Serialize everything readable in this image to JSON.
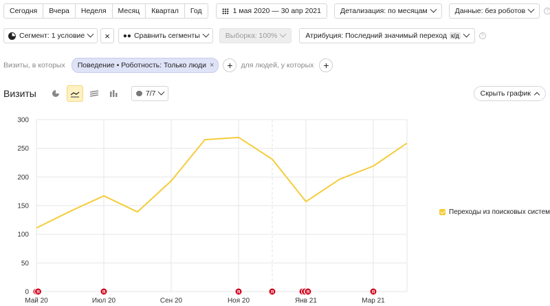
{
  "toolbar": {
    "periods": [
      "Сегодня",
      "Вчера",
      "Неделя",
      "Месяц",
      "Квартал",
      "Год"
    ],
    "date_range": "1 мая 2020 — 30 апр 2021",
    "detail": "Детализация: по месяцам",
    "robots": "Данные: без роботов"
  },
  "segments": {
    "segment": "Сегмент: 1 условие",
    "compare": "Сравнить сегменты",
    "sample": "Выборка: 100%",
    "attribution": "Атрибуция: Последний значимый переход",
    "attribution_badge": "к/д"
  },
  "filter": {
    "prefix": "Визиты, в которых",
    "chip": "Поведение • Роботность: Только люди",
    "people": "для людей, у которых"
  },
  "chart_header": {
    "title": "Визиты",
    "count": "7/7",
    "hide": "Скрыть график"
  },
  "colors": {
    "series": "#f5cc3a",
    "marker": "#d0021b",
    "chip_bg": "#dfe3f7",
    "active_tool": "#fff1c2"
  },
  "chart_data": {
    "type": "line",
    "x": [
      "2020-05",
      "2020-06",
      "2020-07",
      "2020-08",
      "2020-09",
      "2020-10",
      "2020-11",
      "2020-12",
      "2021-01",
      "2021-02",
      "2021-03",
      "2021-04"
    ],
    "x_tick_labels": [
      "Май 20",
      "Июл 20",
      "Сен 20",
      "Ноя 20",
      "Янв 21",
      "Мар 21"
    ],
    "x_tick_indices": [
      0,
      2,
      4,
      6,
      8,
      10
    ],
    "series": [
      {
        "name": "Переходы из поисковых систем",
        "values": [
          111,
          140,
          167,
          139,
          193,
          265,
          269,
          231,
          157,
          196,
          219,
          259
        ]
      }
    ],
    "ylim": [
      0,
      300
    ],
    "yticks": [
      0,
      50,
      100,
      150,
      200,
      250,
      300
    ],
    "grid": true,
    "legend": "right",
    "annotation_marker_label": "Я",
    "annotation_markers": [
      0,
      0.05,
      2,
      6,
      7,
      7.9,
      7.97,
      8.06,
      10
    ]
  }
}
